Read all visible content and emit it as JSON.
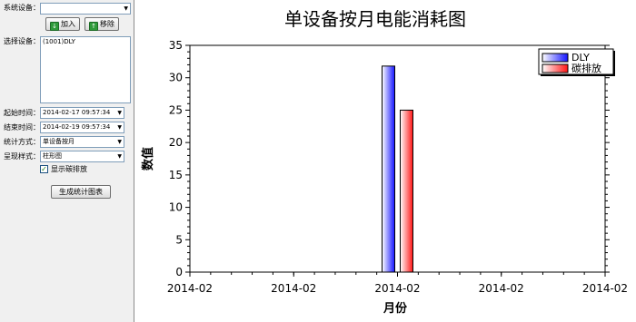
{
  "panel": {
    "system_device_label": "系统设备：",
    "system_device_value": "",
    "add_label": "加入",
    "remove_label": "移除",
    "select_device_label": "选择设备：",
    "devices": [
      "(1001)DLY"
    ],
    "start_time_label": "起始时间：",
    "start_time_value": "2014-02-17 09:57:34",
    "end_time_label": "结束时间：",
    "end_time_value": "2014-02-19 09:57:34",
    "stat_mode_label": "统计方式：",
    "stat_mode_value": "单设备按月",
    "style_label": "呈现样式：",
    "style_value": "柱形图",
    "show_carbon_label": "显示碳排放",
    "show_carbon_checked": true,
    "generate_label": "生成统计图表"
  },
  "chart_data": {
    "type": "bar",
    "title": "单设备按月电能消耗图",
    "xlabel": "月份",
    "ylabel": "数值",
    "xticks": [
      "2014-02",
      "2014-02",
      "2014-02",
      "2014-02",
      "2014-02"
    ],
    "yticks": [
      0,
      5,
      10,
      15,
      20,
      25,
      30,
      35
    ],
    "ylim": [
      0,
      35
    ],
    "categories": [
      "2014-02"
    ],
    "series": [
      {
        "name": "DLY",
        "values": [
          31.8
        ],
        "color": "#1414ff"
      },
      {
        "name": "碳排放",
        "values": [
          25.0
        ],
        "color": "#ff1414"
      }
    ],
    "legend_position": "top-right",
    "grid": false
  }
}
